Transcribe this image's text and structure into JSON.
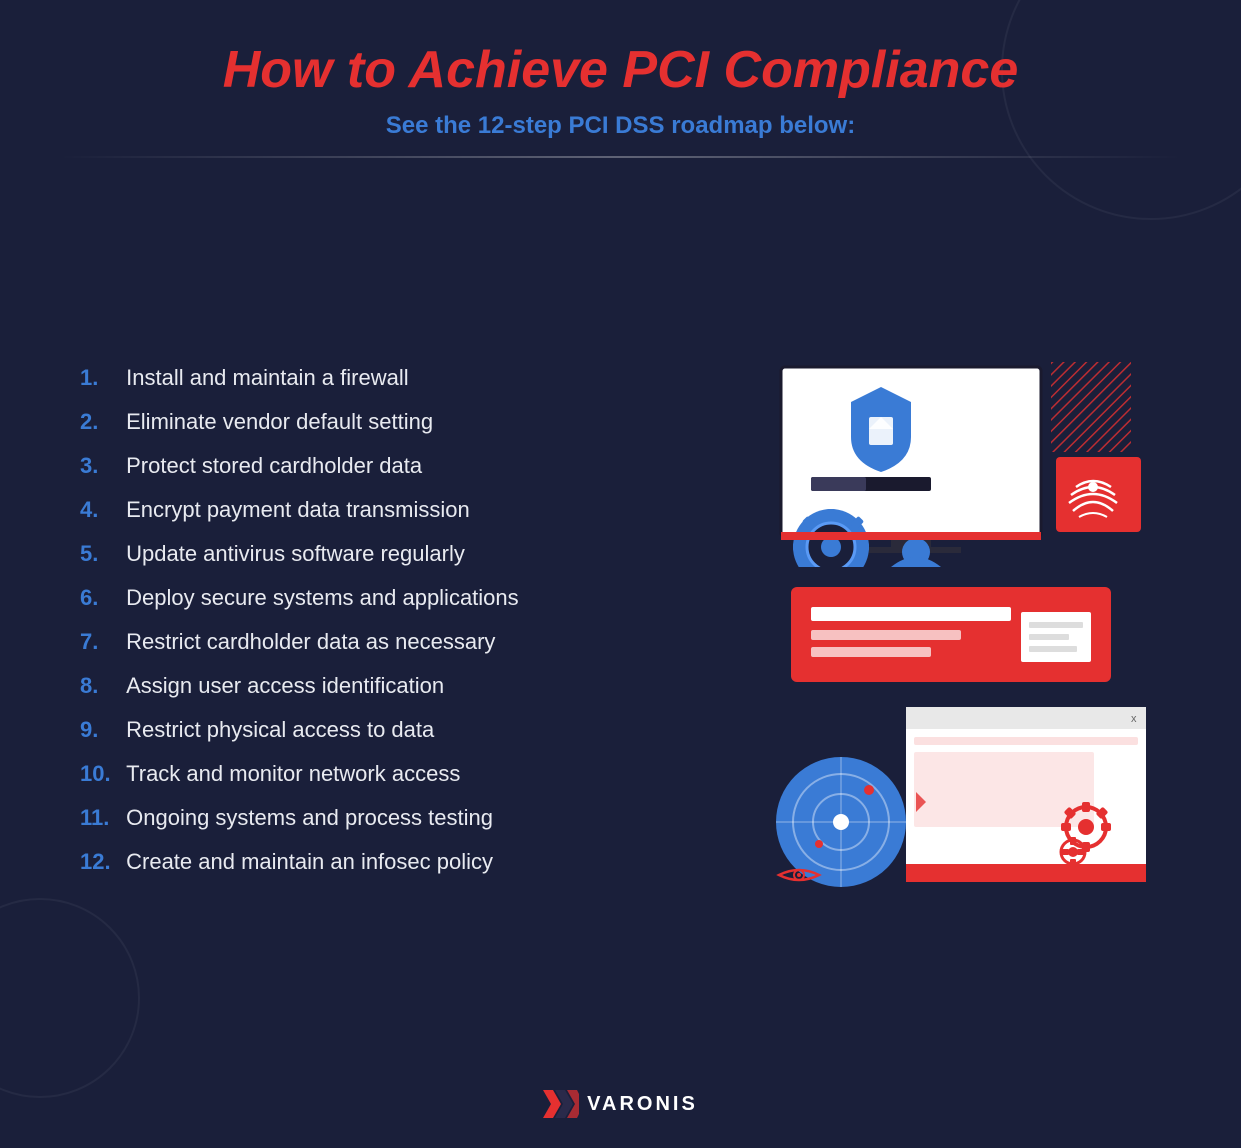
{
  "page": {
    "title": "How to Achieve PCI Compliance",
    "subtitle": "See the 12-step PCI DSS roadmap below:",
    "background_color": "#1a1f3a",
    "accent_red": "#e53030",
    "accent_blue": "#3a7bd5"
  },
  "items": [
    {
      "number": "1.",
      "text": "Install and maintain a firewall"
    },
    {
      "number": "2.",
      "text": "Eliminate vendor default setting"
    },
    {
      "number": "3.",
      "text": "Protect stored cardholder data"
    },
    {
      "number": "4.",
      "text": "Encrypt payment data transmission"
    },
    {
      "number": "5.",
      "text": "Update antivirus software regularly"
    },
    {
      "number": "6.",
      "text": "Deploy secure systems and applications"
    },
    {
      "number": "7.",
      "text": "Restrict cardholder data as necessary"
    },
    {
      "number": "8.",
      "text": "Assign user access identification"
    },
    {
      "number": "9.",
      "text": "Restrict physical access to data"
    },
    {
      "number": "10.",
      "text": "Track and monitor network access"
    },
    {
      "number": "11.",
      "text": "Ongoing systems and process testing"
    },
    {
      "number": "12.",
      "text": "Create and maintain an infosec policy"
    }
  ],
  "footer": {
    "brand": "VARONIS"
  }
}
